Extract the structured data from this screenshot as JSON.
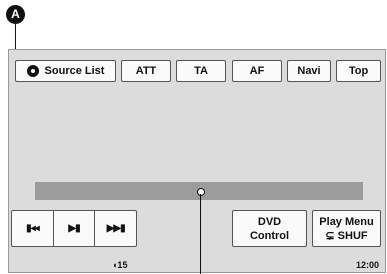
{
  "callout": {
    "label": "A"
  },
  "top_buttons": [
    {
      "label": "Source List"
    },
    {
      "label": "ATT"
    },
    {
      "label": "TA"
    },
    {
      "label": "AF"
    },
    {
      "label": "Navi"
    },
    {
      "label": "Top"
    }
  ],
  "transport": {
    "prev_icon": "▮◂◂",
    "play_pause_icon": "▶▮",
    "next_icon": "▶▶▮"
  },
  "bottom_buttons": {
    "dvd_control": {
      "line1": "DVD",
      "line2": "Control"
    },
    "play_menu": {
      "line1": "Play Menu",
      "line2": "⊊ SHUF"
    }
  },
  "status": {
    "volume": "◖15",
    "time": "12:00"
  }
}
